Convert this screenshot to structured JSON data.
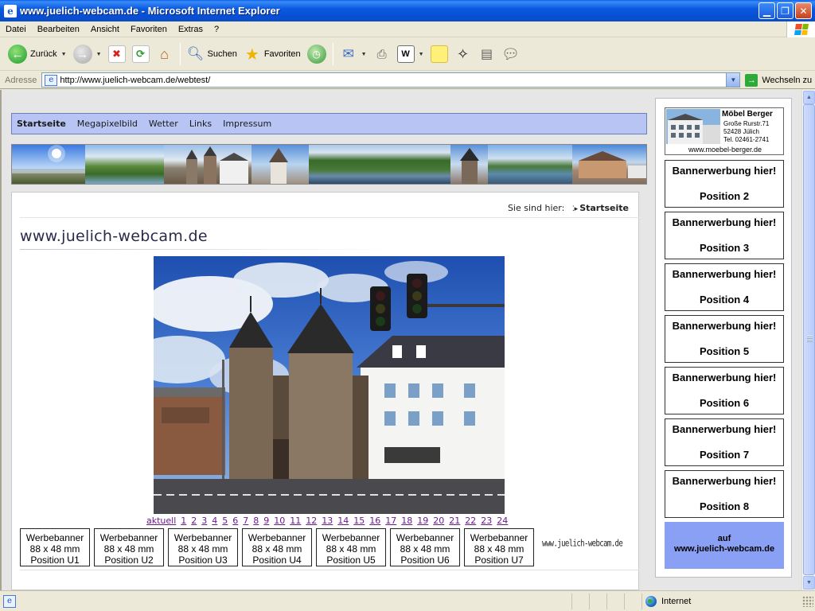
{
  "window": {
    "title": "www.juelich-webcam.de - Microsoft Internet Explorer"
  },
  "menu": [
    "Datei",
    "Bearbeiten",
    "Ansicht",
    "Favoriten",
    "Extras",
    "?"
  ],
  "toolbar": {
    "back": "Zurück",
    "search": "Suchen",
    "favorites": "Favoriten"
  },
  "address": {
    "label": "Adresse",
    "url": "http://www.juelich-webcam.de/webtest/",
    "go": "Wechseln zu"
  },
  "nav": {
    "items": [
      "Startseite",
      "Megapixelbild",
      "Wetter",
      "Links",
      "Impressum"
    ],
    "active_index": 0
  },
  "breadcrumb": {
    "prefix": "Sie sind hier:",
    "current": "Startseite"
  },
  "site_title": "www.juelich-webcam.de",
  "image_links": [
    "aktuell",
    "1",
    "2",
    "3",
    "4",
    "5",
    "6",
    "7",
    "8",
    "9",
    "10",
    "11",
    "12",
    "13",
    "14",
    "15",
    "16",
    "17",
    "18",
    "19",
    "20",
    "21",
    "22",
    "23",
    "24"
  ],
  "web_banners": [
    {
      "line1": "Werbebanner",
      "line2": "88 x 48 mm",
      "line3": "Position U1"
    },
    {
      "line1": "Werbebanner",
      "line2": "88 x 48 mm",
      "line3": "Position U2"
    },
    {
      "line1": "Werbebanner",
      "line2": "88 x 48 mm",
      "line3": "Position U3"
    },
    {
      "line1": "Werbebanner",
      "line2": "88 x 48 mm",
      "line3": "Position U4"
    },
    {
      "line1": "Werbebanner",
      "line2": "88 x 48 mm",
      "line3": "Position U5"
    },
    {
      "line1": "Werbebanner",
      "line2": "88 x 48 mm",
      "line3": "Position U6"
    },
    {
      "line1": "Werbebanner",
      "line2": "88 x 48 mm",
      "line3": "Position U7"
    }
  ],
  "footer_brand": "www.juelich-webcam.de",
  "sponsor": {
    "name": "Möbel Berger",
    "street": "Große Rurstr.71",
    "city": "52428 Jülich",
    "phone": "Tel. 02461-2741",
    "url": "www.moebel-berger.de"
  },
  "side_banners": [
    {
      "line1": "Bannerwerbung hier!",
      "line2": "Position 2"
    },
    {
      "line1": "Bannerwerbung hier!",
      "line2": "Position 3"
    },
    {
      "line1": "Bannerwerbung hier!",
      "line2": "Position 4"
    },
    {
      "line1": "Bannerwerbung hier!",
      "line2": "Position 5"
    },
    {
      "line1": "Bannerwerbung hier!",
      "line2": "Position 6"
    },
    {
      "line1": "Bannerwerbung hier!",
      "line2": "Position 7"
    },
    {
      "line1": "Bannerwerbung hier!",
      "line2": "Position 8"
    }
  ],
  "self_ad": {
    "line1": "auf",
    "line2": "www.juelich-webcam.de"
  },
  "status": {
    "zone": "Internet"
  },
  "colors": {
    "nav_bg": "#b7c4f4",
    "self_ad_bg": "#8aa0f4",
    "link_visited": "#6a1a8c",
    "titlebar": "#0a5ee8"
  }
}
